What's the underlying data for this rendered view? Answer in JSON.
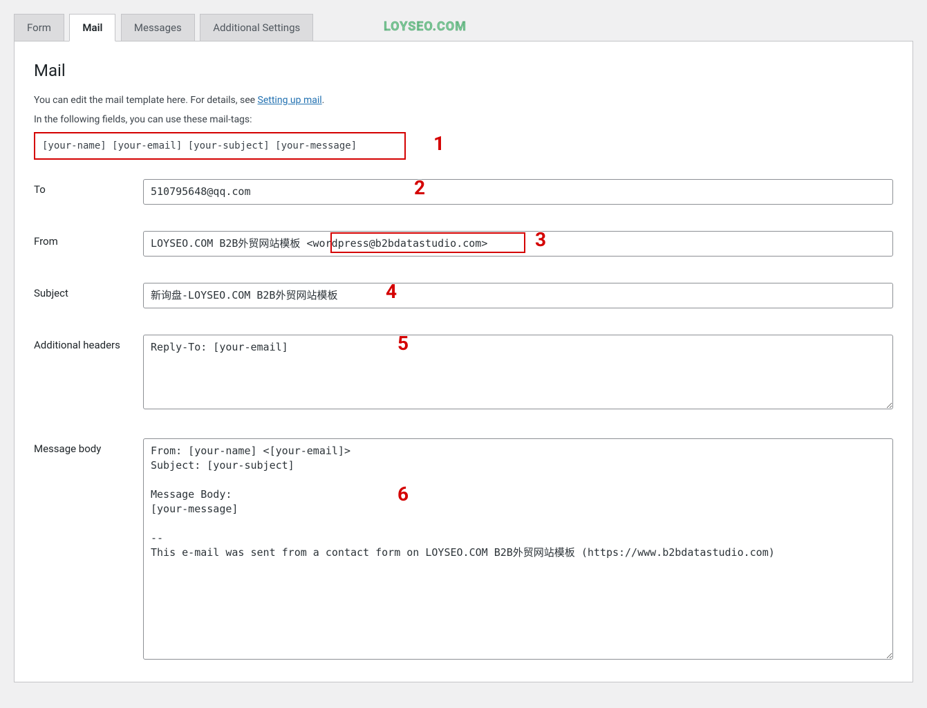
{
  "watermark": "LOYSEO.COM",
  "tabs": [
    {
      "label": "Form",
      "active": false
    },
    {
      "label": "Mail",
      "active": true
    },
    {
      "label": "Messages",
      "active": false
    },
    {
      "label": "Additional Settings",
      "active": false
    }
  ],
  "panel": {
    "title": "Mail",
    "intro_prefix": "You can edit the mail template here. For details, see ",
    "intro_link": "Setting up mail",
    "intro_suffix": ".",
    "tags_note": "In the following fields, you can use these mail-tags:",
    "mail_tags": "[your-name] [your-email] [your-subject] [your-message]"
  },
  "fields": {
    "to": {
      "label": "To",
      "value": "510795648@qq.com"
    },
    "from": {
      "label": "From",
      "value": "LOYSEO.COM B2B外贸网站模板 <wordpress@b2bdatastudio.com>"
    },
    "subject": {
      "label": "Subject",
      "value": "新询盘-LOYSEO.COM B2B外贸网站模板"
    },
    "headers": {
      "label": "Additional headers",
      "value": "Reply-To: [your-email]"
    },
    "body": {
      "label": "Message body",
      "value": "From: [your-name] <[your-email]>\nSubject: [your-subject]\n\nMessage Body:\n[your-message]\n\n-- \nThis e-mail was sent from a contact form on LOYSEO.COM B2B外贸网站模板 (https://www.b2bdatastudio.com)"
    }
  },
  "annotations": {
    "a1": "1",
    "a2": "2",
    "a3": "3",
    "a4": "4",
    "a5": "5",
    "a6": "6"
  }
}
